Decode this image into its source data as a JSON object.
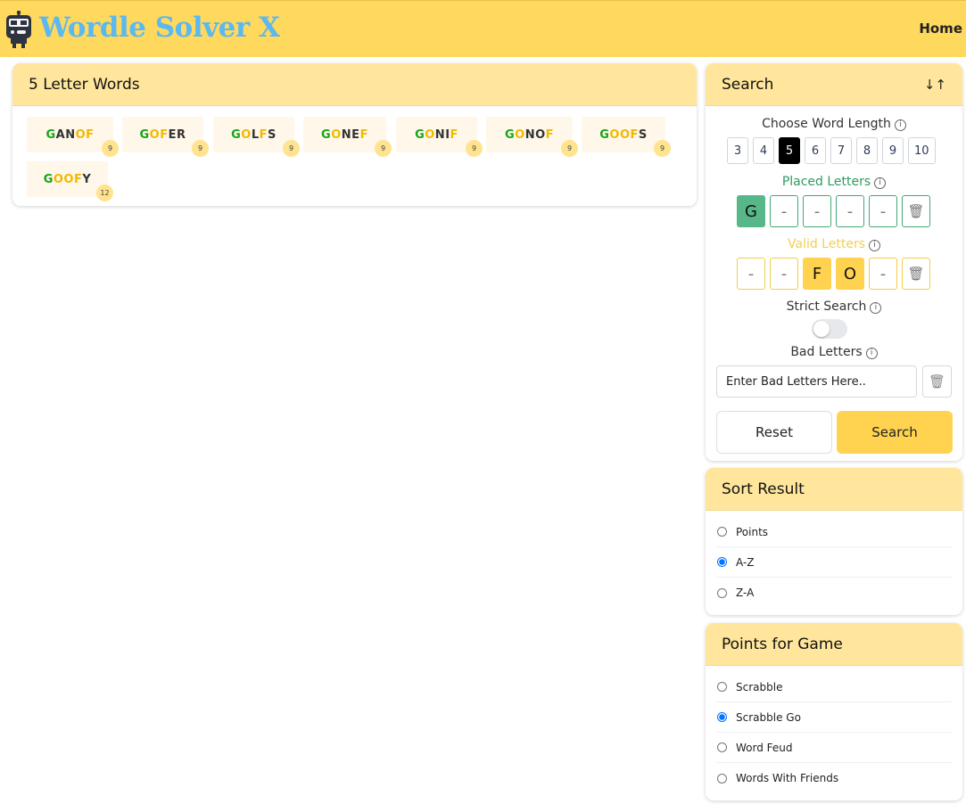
{
  "header": {
    "logo_text": "Wordle Solver X",
    "nav_home": "Home"
  },
  "results": {
    "title": "5 Letter Words",
    "words": [
      {
        "letters": [
          {
            "ch": "G",
            "c": "g"
          },
          {
            "ch": "A",
            "c": "d"
          },
          {
            "ch": "N",
            "c": "d"
          },
          {
            "ch": "O",
            "c": "y"
          },
          {
            "ch": "F",
            "c": "y"
          }
        ],
        "points": "9"
      },
      {
        "letters": [
          {
            "ch": "G",
            "c": "g"
          },
          {
            "ch": "O",
            "c": "y"
          },
          {
            "ch": "F",
            "c": "y"
          },
          {
            "ch": "E",
            "c": "d"
          },
          {
            "ch": "R",
            "c": "d"
          }
        ],
        "points": "9"
      },
      {
        "letters": [
          {
            "ch": "G",
            "c": "g"
          },
          {
            "ch": "O",
            "c": "y"
          },
          {
            "ch": "L",
            "c": "d"
          },
          {
            "ch": "F",
            "c": "y"
          },
          {
            "ch": "S",
            "c": "d"
          }
        ],
        "points": "9"
      },
      {
        "letters": [
          {
            "ch": "G",
            "c": "g"
          },
          {
            "ch": "O",
            "c": "y"
          },
          {
            "ch": "N",
            "c": "d"
          },
          {
            "ch": "E",
            "c": "d"
          },
          {
            "ch": "F",
            "c": "y"
          }
        ],
        "points": "9"
      },
      {
        "letters": [
          {
            "ch": "G",
            "c": "g"
          },
          {
            "ch": "O",
            "c": "y"
          },
          {
            "ch": "N",
            "c": "d"
          },
          {
            "ch": "I",
            "c": "d"
          },
          {
            "ch": "F",
            "c": "y"
          }
        ],
        "points": "9"
      },
      {
        "letters": [
          {
            "ch": "G",
            "c": "g"
          },
          {
            "ch": "O",
            "c": "y"
          },
          {
            "ch": "N",
            "c": "d"
          },
          {
            "ch": "O",
            "c": "d"
          },
          {
            "ch": "F",
            "c": "y"
          }
        ],
        "points": "9"
      },
      {
        "letters": [
          {
            "ch": "G",
            "c": "g"
          },
          {
            "ch": "O",
            "c": "y"
          },
          {
            "ch": "O",
            "c": "y"
          },
          {
            "ch": "F",
            "c": "y"
          },
          {
            "ch": "S",
            "c": "d"
          }
        ],
        "points": "9"
      },
      {
        "letters": [
          {
            "ch": "G",
            "c": "g"
          },
          {
            "ch": "O",
            "c": "y"
          },
          {
            "ch": "O",
            "c": "y"
          },
          {
            "ch": "F",
            "c": "y"
          },
          {
            "ch": "Y",
            "c": "d"
          }
        ],
        "points": "12"
      }
    ]
  },
  "search": {
    "title": "Search",
    "sort_icon": "sort-arrows-icon",
    "word_length_label": "Choose Word Length",
    "lengths": [
      "3",
      "4",
      "5",
      "6",
      "7",
      "8",
      "9",
      "10"
    ],
    "selected_length": "5",
    "placed_label": "Placed Letters",
    "placed": [
      "G",
      "-",
      "-",
      "-",
      "-"
    ],
    "valid_label": "Valid Letters",
    "valid": [
      "-",
      "-",
      "F",
      "O",
      "-"
    ],
    "strict_label": "Strict Search",
    "strict_on": false,
    "bad_label": "Bad Letters",
    "bad_placeholder": "Enter Bad Letters Here..",
    "reset_label": "Reset",
    "search_label": "Search"
  },
  "sort": {
    "title": "Sort Result",
    "options": [
      "Points",
      "A-Z",
      "Z-A"
    ],
    "selected": "A-Z"
  },
  "points": {
    "title": "Points for Game",
    "options": [
      "Scrabble",
      "Scrabble Go",
      "Word Feud",
      "Words With Friends"
    ],
    "selected": "Scrabble Go"
  },
  "colors": {
    "header_bg": "#ffd85e",
    "card_head": "#ffe69c",
    "green_tile": "#57b788",
    "yellow_tile": "#ffd34f",
    "logo_text": "#5cb8f0"
  }
}
